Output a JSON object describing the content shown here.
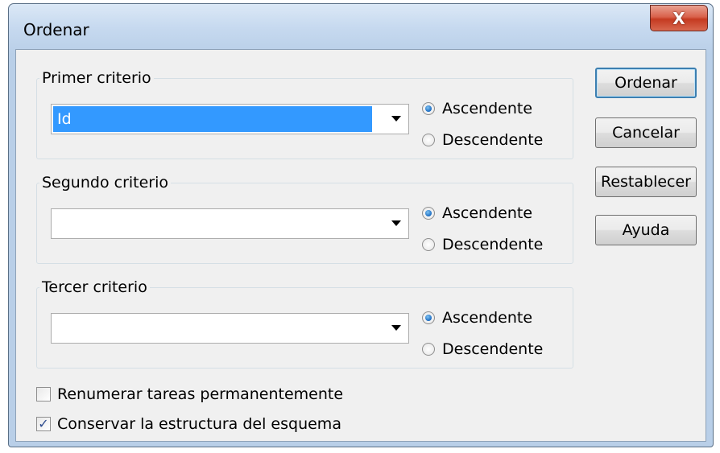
{
  "window": {
    "title": "Ordenar",
    "close_label": "X"
  },
  "groups": [
    {
      "legend": "Primer criterio",
      "field_value": "Id",
      "field_selected": true,
      "ascending_label": "Ascendente",
      "descending_label": "Descendente",
      "selected": "ascending"
    },
    {
      "legend": "Segundo criterio",
      "field_value": "",
      "field_selected": false,
      "ascending_label": "Ascendente",
      "descending_label": "Descendente",
      "selected": "ascending"
    },
    {
      "legend": "Tercer criterio",
      "field_value": "",
      "field_selected": false,
      "ascending_label": "Ascendente",
      "descending_label": "Descendente",
      "selected": "ascending"
    }
  ],
  "buttons": {
    "sort": "Ordenar",
    "cancel": "Cancelar",
    "reset": "Restablecer",
    "help": "Ayuda"
  },
  "options": {
    "renumber": {
      "label": "Renumerar tareas permanentemente",
      "checked": false
    },
    "keep_outline": {
      "label": "Conservar la estructura del esquema",
      "checked": true
    }
  },
  "icons": {
    "check_glyph": "✓"
  }
}
